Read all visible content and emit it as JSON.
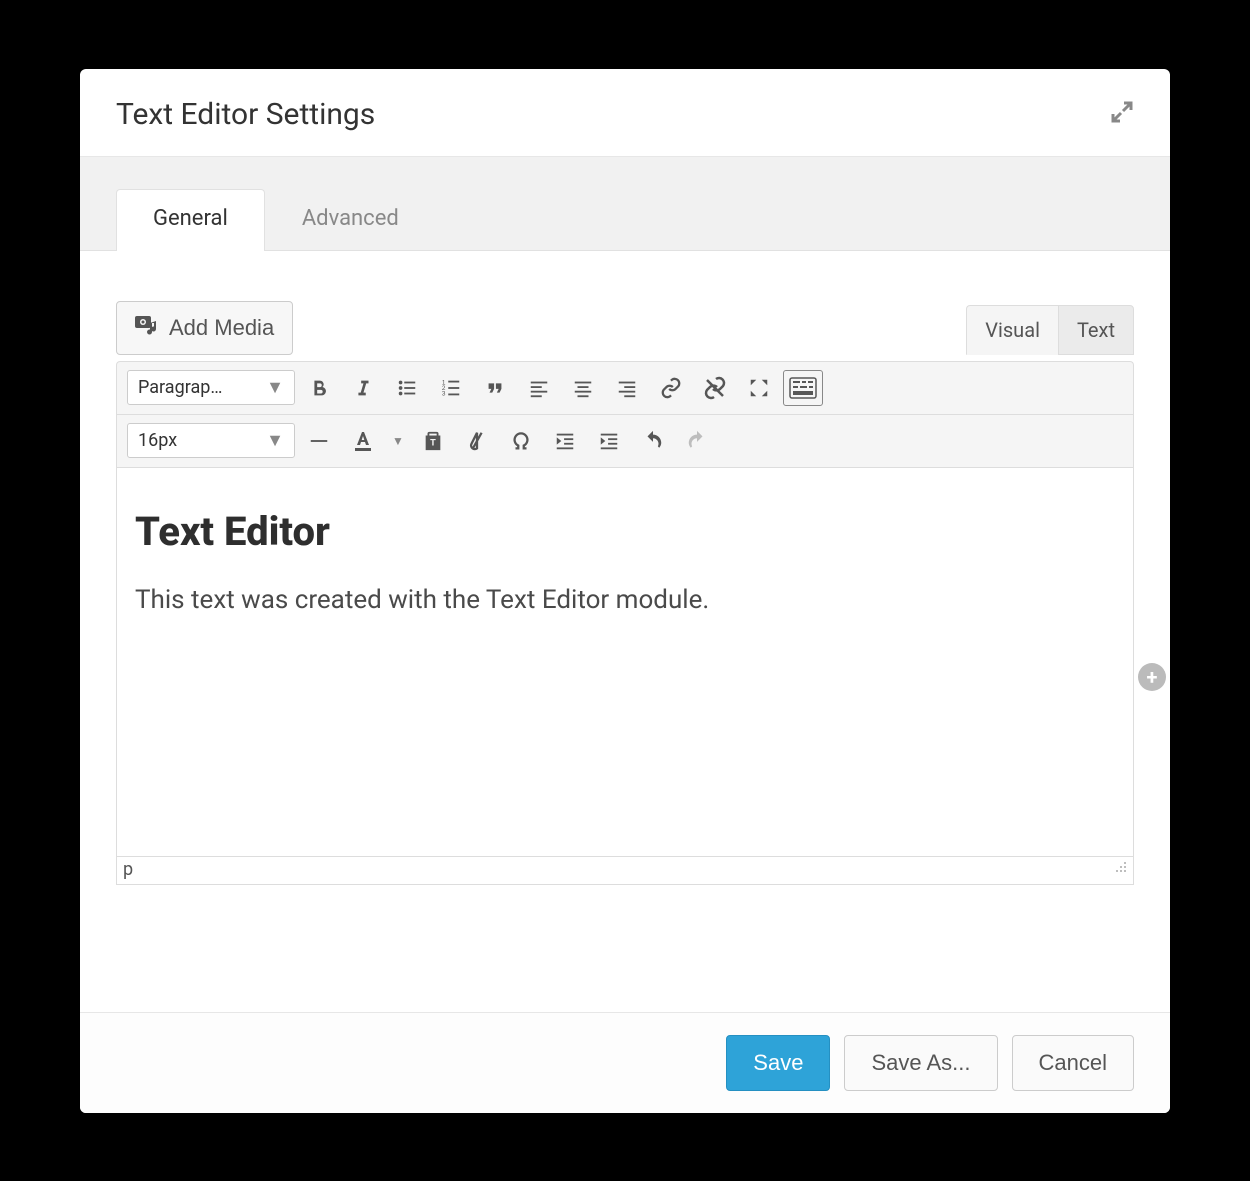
{
  "modal": {
    "title": "Text Editor Settings"
  },
  "tabs": {
    "general": "General",
    "advanced": "Advanced"
  },
  "mediaButton": "Add Media",
  "editorTabs": {
    "visual": "Visual",
    "text": "Text"
  },
  "toolbar": {
    "formatDropdown": "Paragrap…",
    "fontSizeDropdown": "16px"
  },
  "editorContent": {
    "heading": "Text Editor",
    "paragraph": "This text was created with the Text Editor module."
  },
  "statusBar": "p",
  "footer": {
    "save": "Save",
    "saveAs": "Save As...",
    "cancel": "Cancel"
  }
}
